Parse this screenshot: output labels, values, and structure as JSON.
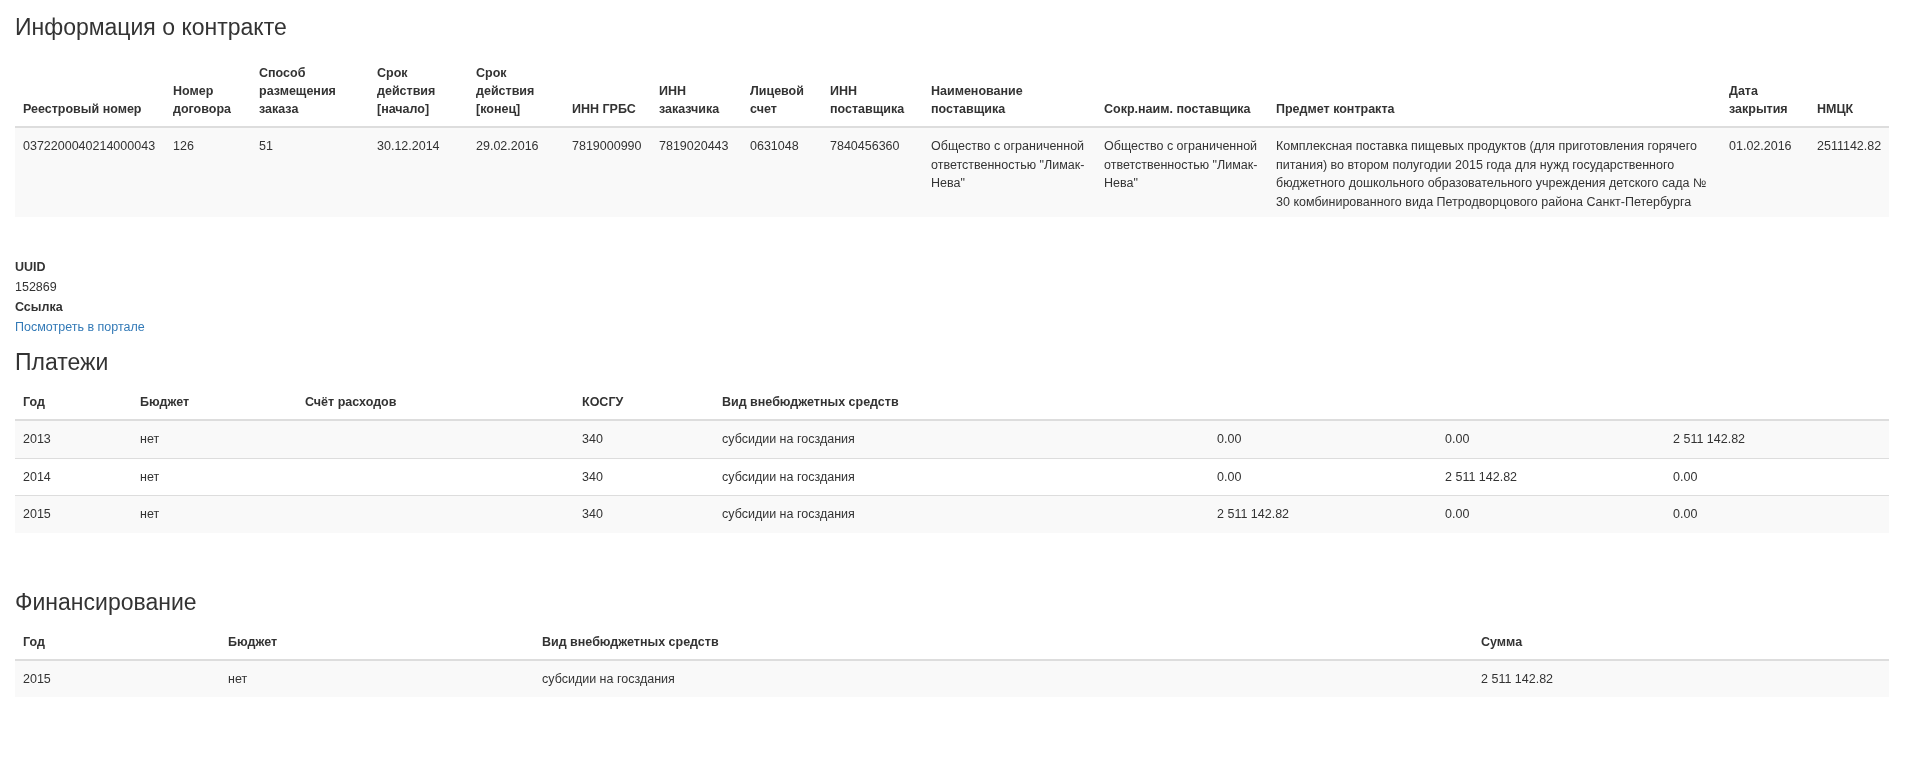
{
  "contract": {
    "title": "Информация о контракте",
    "columns": [
      "Реестровый номер",
      "Номер договора",
      "Способ размещения заказа",
      "Срок действия [начало]",
      "Срок действия [конец]",
      "ИНН ГРБС",
      "ИНН заказчика",
      "Лицевой счет",
      "ИНН поставщика",
      "Наименование поставщика",
      "Сокр.наим. поставщика",
      "Предмет контракта",
      "Дата закрытия",
      "НМЦК"
    ],
    "rows": [
      [
        "0372200040214000043",
        "126",
        "51",
        "30.12.2014",
        "29.02.2016",
        "7819000990",
        "7819020443",
        "0631048",
        "7840456360",
        "Общество с ограниченной ответственностью \"Лимак-Нева\"",
        "Общество с ограниченной ответственностью \"Лимак-Нева\"",
        "Комплексная поставка пищевых продуктов (для приготовления горячего питания) во втором полугодии 2015 года для нужд государственного бюджетного дошкольного образовательного учреждения детского сада № 30 комбинированного вида Петродворцового района Санкт-Петербурга",
        "01.02.2016",
        "2511142.82"
      ]
    ]
  },
  "details": [
    {
      "label": "UUID",
      "value": "152869"
    },
    {
      "label": "Ссылка",
      "link": "Посмотреть в портале"
    }
  ],
  "payments": {
    "title": "Платежи",
    "columns": [
      "Год",
      "Бюджет",
      "Счёт расходов",
      "КОСГУ",
      "Вид внебюджетных средств"
    ],
    "rows": [
      [
        "2013",
        "нет",
        "",
        "340",
        "субсидии на госздания",
        "0.00",
        "0.00",
        "2 511 142.82"
      ],
      [
        "2014",
        "нет",
        "",
        "340",
        "субсидии на госздания",
        "0.00",
        "2 511 142.82",
        "0.00"
      ],
      [
        "2015",
        "нет",
        "",
        "340",
        "субсидии на госздания",
        "2 511 142.82",
        "0.00",
        "0.00"
      ]
    ]
  },
  "financing": {
    "title": "Финансирование",
    "columns": [
      "Год",
      "Бюджет",
      "Вид внебюджетных средств",
      "Сумма"
    ],
    "rows": [
      [
        "2015",
        "нет",
        "субсидии на госздания",
        "2 511 142.82"
      ]
    ]
  }
}
